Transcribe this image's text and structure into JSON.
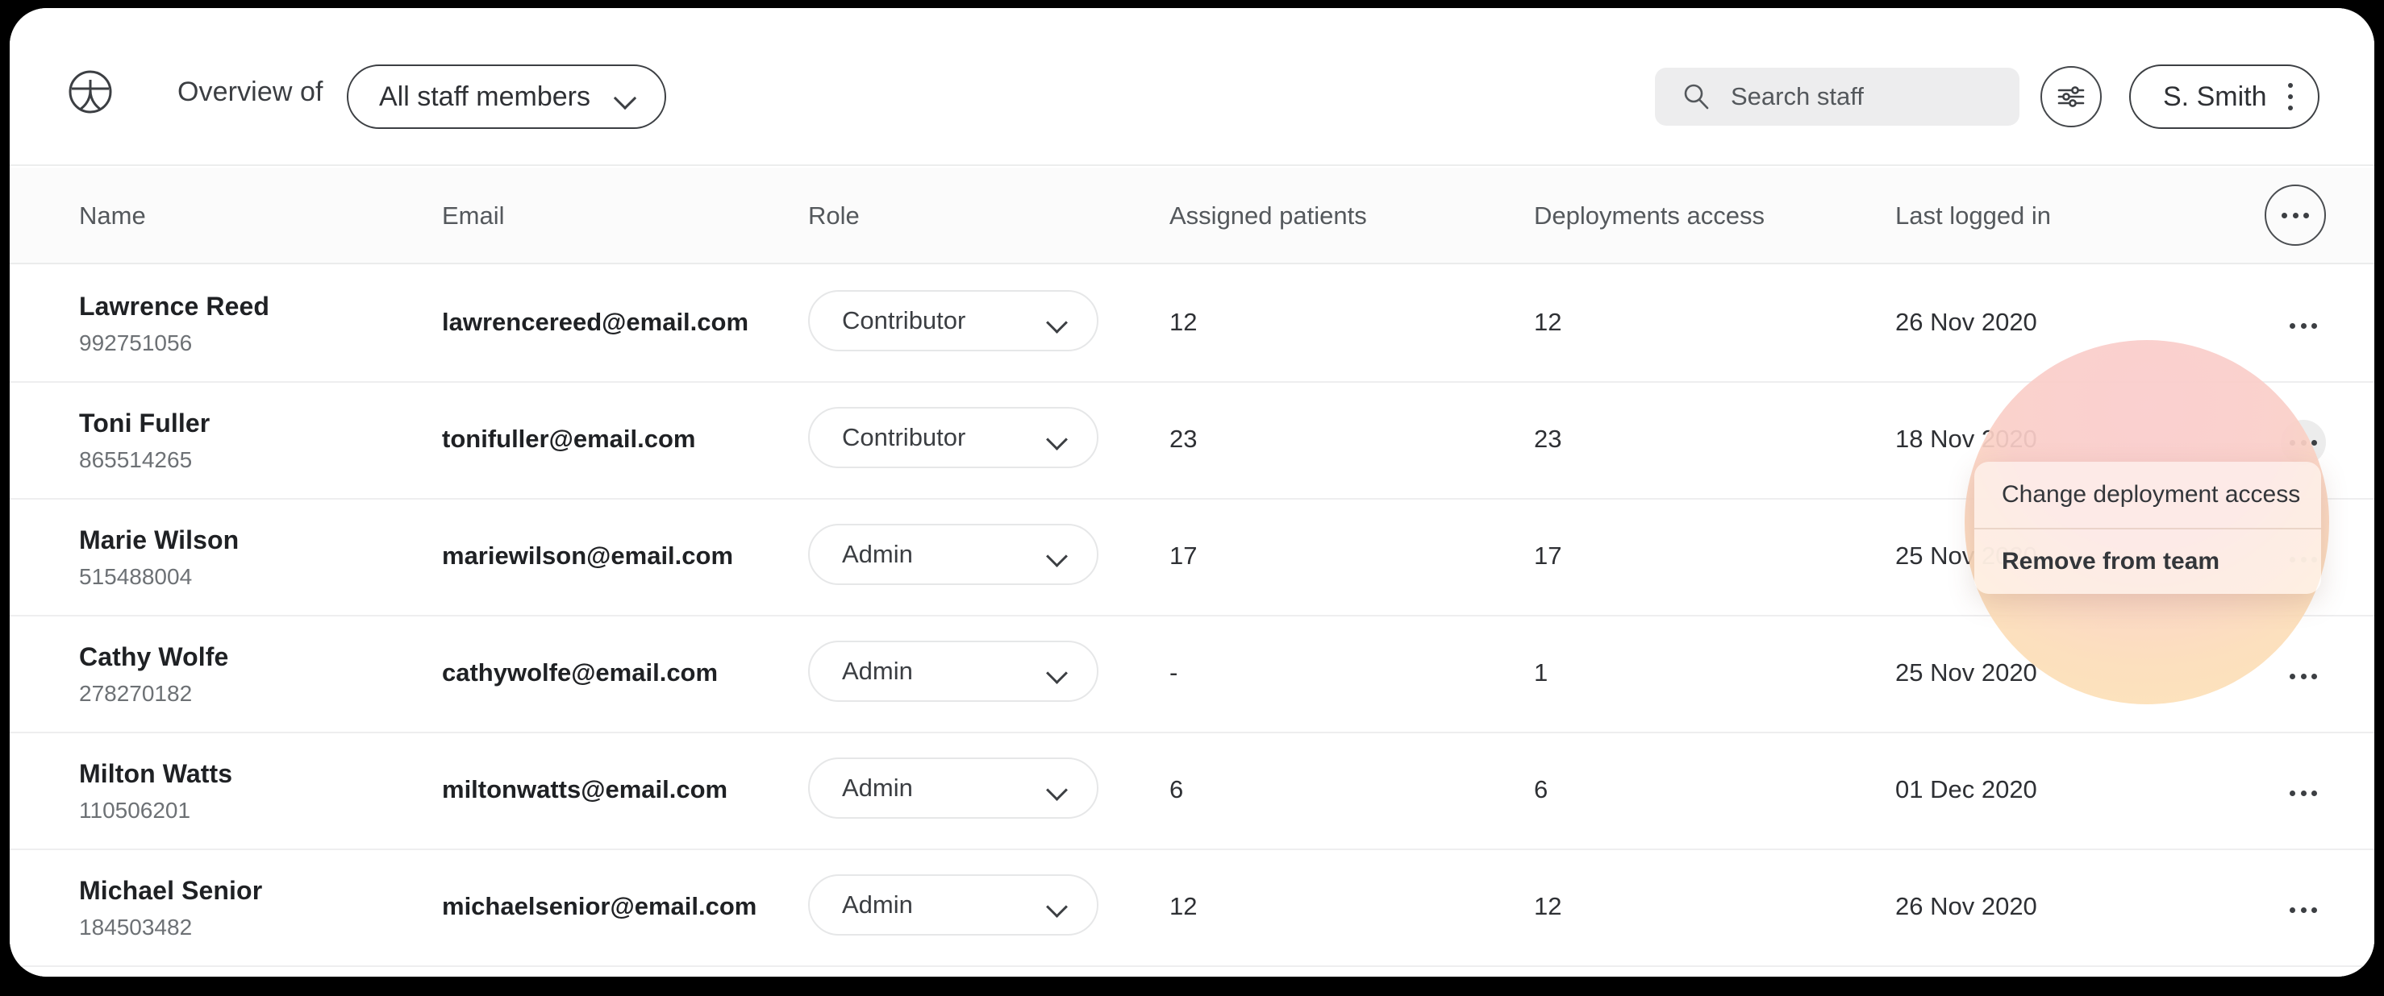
{
  "header": {
    "logo_icon": "circle-person-logo-icon",
    "overview_label": "Overview of",
    "scope_value": "All staff members",
    "scope_chevron_icon": "chevron-down-icon",
    "search": {
      "icon": "search-icon",
      "placeholder": "Search staff",
      "value": ""
    },
    "filter_icon": "sliders-filter-icon",
    "user": {
      "name": "S. Smith",
      "menu_icon": "kebab-vertical-icon"
    }
  },
  "table": {
    "columns": [
      "Name",
      "Email",
      "Role",
      "Assigned patients",
      "Deployments access",
      "Last logged in"
    ],
    "header_more_icon": "kebab-horizontal-icon",
    "row_more_icon": "kebab-horizontal-icon",
    "rows": [
      {
        "name": "Lawrence Reed",
        "id": "992751056",
        "email": "lawrencereed@email.com",
        "role": "Contributor",
        "assigned_patients": "12",
        "deployments_access": "12",
        "last_logged_in": "26 Nov 2020"
      },
      {
        "name": "Toni Fuller",
        "id": "865514265",
        "email": "tonifuller@email.com",
        "role": "Contributor",
        "assigned_patients": "23",
        "deployments_access": "23",
        "last_logged_in": "18 Nov 2020"
      },
      {
        "name": "Marie Wilson",
        "id": "515488004",
        "email": "mariewilson@email.com",
        "role": "Admin",
        "assigned_patients": "17",
        "deployments_access": "17",
        "last_logged_in": "25 Nov 2020"
      },
      {
        "name": "Cathy Wolfe",
        "id": "278270182",
        "email": "cathywolfe@email.com",
        "role": "Admin",
        "assigned_patients": "-",
        "deployments_access": "1",
        "last_logged_in": "25 Nov 2020"
      },
      {
        "name": "Milton Watts",
        "id": "110506201",
        "email": "miltonwatts@email.com",
        "role": "Admin",
        "assigned_patients": "6",
        "deployments_access": "6",
        "last_logged_in": "01 Dec 2020"
      },
      {
        "name": "Michael Senior",
        "id": "184503482",
        "email": "michaelsenior@email.com",
        "role": "Admin",
        "assigned_patients": "12",
        "deployments_access": "12",
        "last_logged_in": "26 Nov 2020"
      }
    ]
  },
  "context_menu": {
    "open_on_row_index": 1,
    "items": [
      "Change deployment access",
      "Remove from team"
    ]
  },
  "colors": {
    "page_background": "#000000",
    "card_background": "#ffffff",
    "table_header_background": "#fbfbfb",
    "row_divider": "#eeeeef",
    "search_background": "#ededee",
    "text_primary": "#1f2124",
    "text_secondary": "#6d7175",
    "highlight_pink": "#facdcd",
    "highlight_orange": "#fde2b4"
  }
}
